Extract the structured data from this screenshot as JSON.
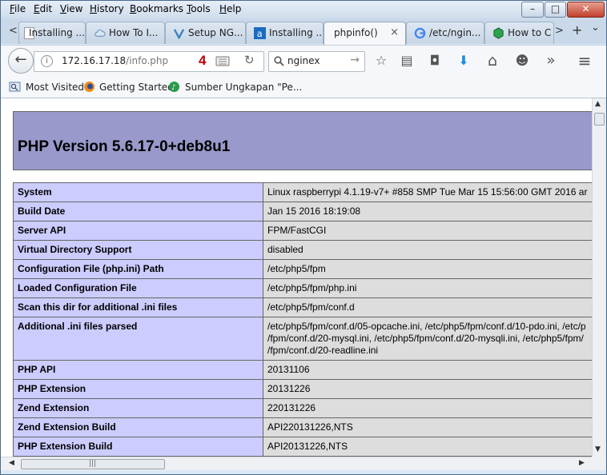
{
  "menu": {
    "items": [
      {
        "label": "File",
        "underline": "F",
        "rest": "ile"
      },
      {
        "label": "Edit",
        "underline": "E",
        "rest": "dit"
      },
      {
        "label": "View",
        "underline": "V",
        "rest": "iew"
      },
      {
        "label": "History",
        "underline": "H",
        "rest": "istory"
      },
      {
        "label": "Bookmarks",
        "underline": "B",
        "rest": "ookmarks"
      },
      {
        "label": "Tools",
        "underline": "T",
        "rest": "ools"
      },
      {
        "label": "Help",
        "underline": "H",
        "rest": "elp"
      }
    ],
    "minimize": "–",
    "maximize": "□",
    "close": "✕"
  },
  "tabs": [
    {
      "label": "Installing ...",
      "icon": "page-icon"
    },
    {
      "label": "How To I...",
      "icon": "cloud-icon"
    },
    {
      "label": "Setup NG...",
      "icon": "v-logo-icon"
    },
    {
      "label": "Installing ...",
      "icon": "a-logo-icon"
    },
    {
      "label": "phpinfo()",
      "icon": "none",
      "active": true
    },
    {
      "label": "/etc/ngin...",
      "icon": "google-icon"
    },
    {
      "label": "How to C",
      "icon": "cube-icon"
    }
  ],
  "tabstrip": {
    "scroll_left": "<",
    "scroll_right": ">",
    "new_tab": "+",
    "list_tabs": "⌄",
    "tab_close": "×"
  },
  "navbar": {
    "url_host": "172.16.17.18",
    "url_path": "/info.php",
    "annotation_marker": "4",
    "search_value": "nginex",
    "back": "←",
    "reload": "↻",
    "search_go": "→",
    "info": "i",
    "tools": [
      {
        "name": "bookmark-star-icon",
        "glyph": "☆"
      },
      {
        "name": "bookmarks-library-icon",
        "glyph": "▤"
      },
      {
        "name": "pocket-icon",
        "glyph": "◘"
      },
      {
        "name": "downloads-icon",
        "glyph": "⬇"
      },
      {
        "name": "home-icon",
        "glyph": "⌂"
      },
      {
        "name": "hello-icon",
        "glyph": "☻"
      },
      {
        "name": "overflow-icon",
        "glyph": "»"
      },
      {
        "name": "menu-icon",
        "glyph": "≡"
      }
    ]
  },
  "bookmarks": [
    {
      "label": "Most Visited"
    },
    {
      "label": "Getting Started"
    },
    {
      "label": "Sumber Ungkapan \"Pe..."
    }
  ],
  "page": {
    "title": "PHP Version 5.6.17-0+deb8u1",
    "rows": [
      {
        "key": "System",
        "value": "Linux raspberrypi 4.1.19-v7+ #858 SMP Tue Mar 15 15:56:00 GMT 2016 ar"
      },
      {
        "key": "Build Date",
        "value": "Jan 15 2016 18:19:08"
      },
      {
        "key": "Server API",
        "value": "FPM/FastCGI"
      },
      {
        "key": "Virtual Directory Support",
        "value": "disabled"
      },
      {
        "key": "Configuration File (php.ini) Path",
        "value": "/etc/php5/fpm"
      },
      {
        "key": "Loaded Configuration File",
        "value": "/etc/php5/fpm/php.ini"
      },
      {
        "key": "Scan this dir for additional .ini files",
        "value": "/etc/php5/fpm/conf.d"
      },
      {
        "key": "Additional .ini files parsed",
        "value": "/etc/php5/fpm/conf.d/05-opcache.ini, /etc/php5/fpm/conf.d/10-pdo.ini, /etc/p\n/fpm/conf.d/20-mysql.ini, /etc/php5/fpm/conf.d/20-mysqli.ini, /etc/php5/fpm/\n/fpm/conf.d/20-readline.ini"
      },
      {
        "key": "PHP API",
        "value": "20131106"
      },
      {
        "key": "PHP Extension",
        "value": "20131226"
      },
      {
        "key": "Zend Extension",
        "value": "220131226"
      },
      {
        "key": "Zend Extension Build",
        "value": "API220131226,NTS"
      },
      {
        "key": "PHP Extension Build",
        "value": "API20131226,NTS"
      }
    ]
  },
  "scroll": {
    "up": "▲",
    "down": "▼",
    "left": "◀",
    "right": "▶",
    "grip": "|||"
  },
  "colors": {
    "php_header": "#9999cc",
    "key_cell": "#ccccff",
    "value_cell": "#dddddd",
    "marker": "#bb0000"
  }
}
